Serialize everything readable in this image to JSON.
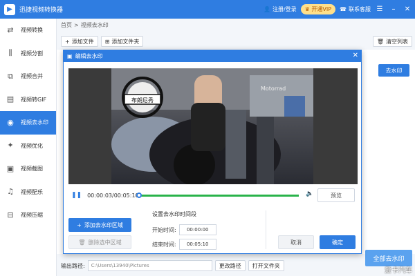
{
  "app": {
    "title": "迅捷视频转换器",
    "login": "注册/登录",
    "vip": "开通VIP",
    "support": "联系客服"
  },
  "sidebar": {
    "items": [
      {
        "label": "视频转换",
        "icon": "convert-icon"
      },
      {
        "label": "视频分割",
        "icon": "split-icon"
      },
      {
        "label": "视频合并",
        "icon": "merge-icon"
      },
      {
        "label": "视频转GIF",
        "icon": "gif-icon"
      },
      {
        "label": "视频去水印",
        "icon": "watermark-icon"
      },
      {
        "label": "视频优化",
        "icon": "optimize-icon"
      },
      {
        "label": "视频截图",
        "icon": "screenshot-icon"
      },
      {
        "label": "视频配乐",
        "icon": "music-icon"
      },
      {
        "label": "视频压缩",
        "icon": "compress-icon"
      }
    ],
    "active_index": 4
  },
  "breadcrumb": {
    "home": "首页",
    "sep": ">",
    "current": "视频去水印"
  },
  "toolbar": {
    "add_file": "添加文件",
    "add_folder": "添加文件夹",
    "clear_list": "清空列表"
  },
  "main": {
    "remove_watermark_btn": "去水印"
  },
  "bottom": {
    "output_label": "输出路径:",
    "output_path": "C:\\Users\\13940\\Pictures",
    "change_path": "更改路径",
    "open_folder": "打开文件夹",
    "remove_all": "全部去水印",
    "corner_watermark": "爱卡汽车"
  },
  "dialog": {
    "title": "编辑去水印",
    "time_display": "00:00:03/00:05:10",
    "progress_fraction": 1.0,
    "preview_btn": "预览",
    "add_region": "添加去水印区域",
    "delete_region": "删除选中区域",
    "time_section_title": "设置去水印时间段",
    "start_label": "开始时间:",
    "start_value": "00:00:00",
    "end_label": "结束时间:",
    "end_value": "00:05:10",
    "cancel": "取消",
    "ok": "确定",
    "video_overlay_text": "布朗尼秀",
    "video_sign_text": "Motorrad"
  }
}
